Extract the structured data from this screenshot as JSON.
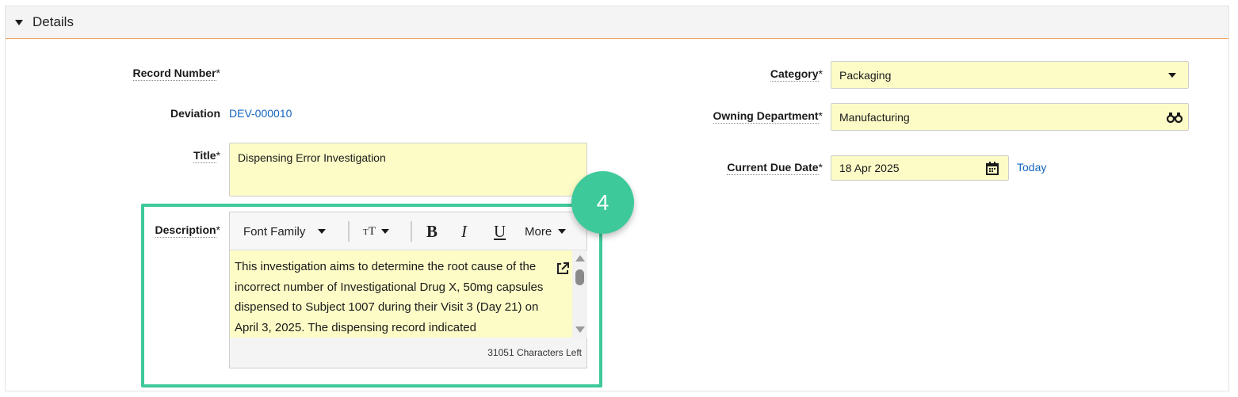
{
  "section": {
    "title": "Details"
  },
  "fields": {
    "record_number": {
      "label": "Record Number",
      "required_mark": "*"
    },
    "deviation": {
      "label": "Deviation",
      "value": "DEV-000010"
    },
    "title": {
      "label": "Title",
      "required_mark": "*",
      "value": "Dispensing Error Investigation"
    },
    "description": {
      "label": "Description",
      "required_mark": "*",
      "text": "This investigation aims to determine the root cause of the incorrect number of Investigational Drug X, 50mg capsules dispensed to Subject 1007 during their Visit 3 (Day 21) on April 3, 2025. The dispensing record indicated",
      "chars_left": "31051 Characters Left"
    },
    "category": {
      "label": "Category",
      "required_mark": "*",
      "value": "Packaging"
    },
    "owning_department": {
      "label": "Owning Department",
      "required_mark": "*",
      "value": "Manufacturing"
    },
    "current_due_date": {
      "label": "Current Due Date",
      "required_mark": "*",
      "value": "18 Apr 2025",
      "today_link": "Today"
    }
  },
  "toolbar": {
    "font_family": "Font Family",
    "font_size_icon": "text-size-icon",
    "bold": "B",
    "italic": "I",
    "underline": "U",
    "more": "More"
  },
  "annotation": {
    "step": "4",
    "color": "#3ec99b"
  },
  "colors": {
    "field_bg": "#fdfcc7",
    "link": "#1565c0",
    "header_border": "#f0a25a"
  }
}
